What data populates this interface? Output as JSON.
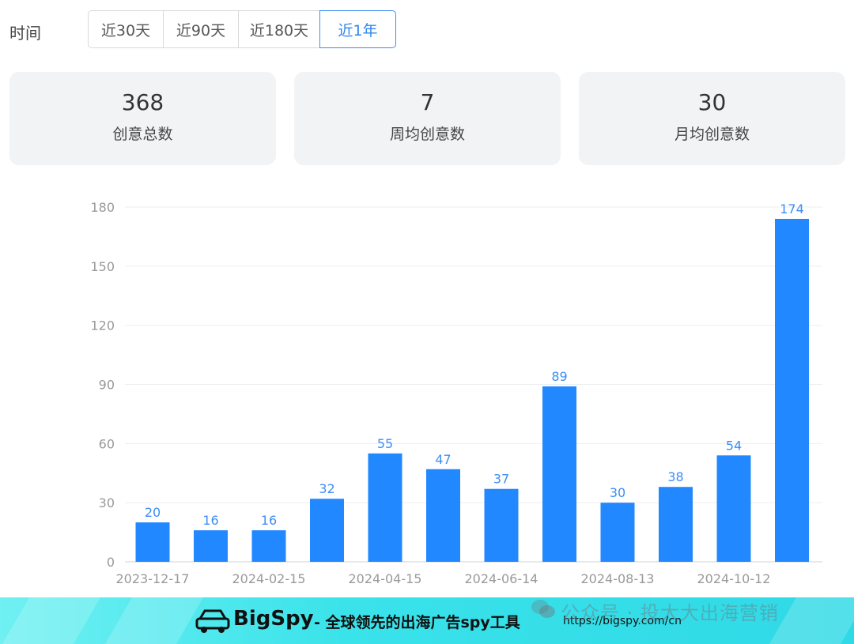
{
  "filter": {
    "label": "时间",
    "tabs": [
      "近30天",
      "近90天",
      "近180天",
      "近1年"
    ],
    "active_index": 3
  },
  "stats": [
    {
      "value": "368",
      "label": "创意总数"
    },
    {
      "value": "7",
      "label": "周均创意数"
    },
    {
      "value": "30",
      "label": "月均创意数"
    }
  ],
  "chart_data": {
    "type": "bar",
    "categories": [
      "2023-12-17",
      "",
      "2024-02-15",
      "",
      "2024-04-15",
      "",
      "2024-06-14",
      "",
      "2024-08-13",
      "",
      "2024-10-12",
      ""
    ],
    "values": [
      20,
      16,
      16,
      32,
      55,
      47,
      37,
      89,
      30,
      38,
      54,
      174
    ],
    "ylim": [
      0,
      180
    ],
    "yticks": [
      0,
      30,
      60,
      90,
      120,
      150,
      180
    ],
    "grid": true,
    "bar_color": "#2288ff",
    "label_color": "#3d8ef5"
  },
  "banner": {
    "brand": "BigSpy",
    "slogan": "- 全球领先的出海广告spy工具",
    "url": "https://bigspy.com/cn",
    "watermark": "公众号 · 投大大出海营销"
  },
  "colors": {
    "accent": "#2f86f0",
    "card_bg": "#f1f3f5",
    "banner": "#3ae3ea"
  }
}
